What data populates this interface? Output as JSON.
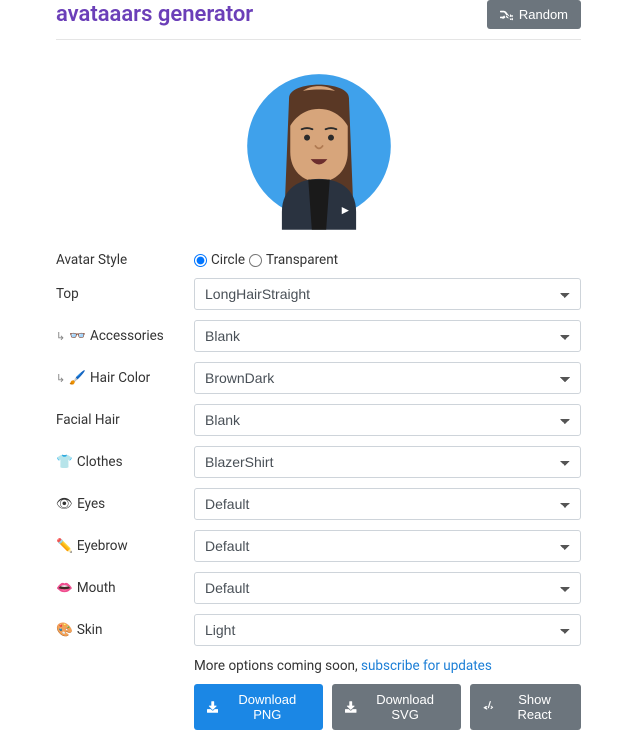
{
  "header": {
    "title": "avataaars generator",
    "random_label": "Random"
  },
  "style_row": {
    "label": "Avatar Style",
    "option_circle": "Circle",
    "option_transparent": "Transparent",
    "selected": "Circle"
  },
  "rows": {
    "top": {
      "label": "Top",
      "value": "LongHairStraight"
    },
    "accessories": {
      "label": "Accessories",
      "icon_hint": "glasses",
      "value": "Blank"
    },
    "hair_color": {
      "label": "Hair Color",
      "icon_hint": "brush",
      "value": "BrownDark"
    },
    "facial_hair": {
      "label": "Facial Hair",
      "value": "Blank"
    },
    "clothes": {
      "label": "Clothes",
      "icon_hint": "shirt",
      "value": "BlazerShirt"
    },
    "eyes": {
      "label": "Eyes",
      "icon_hint": "eye",
      "value": "Default"
    },
    "eyebrow": {
      "label": "Eyebrow",
      "icon_hint": "brow",
      "value": "Default"
    },
    "mouth": {
      "label": "Mouth",
      "icon_hint": "mouth",
      "value": "Default"
    },
    "skin": {
      "label": "Skin",
      "icon_hint": "palette",
      "value": "Light"
    }
  },
  "footer": {
    "more_text": "More options coming soon, ",
    "subscribe_text": "subscribe for updates",
    "download_png": "Download PNG",
    "download_svg": "Download SVG",
    "show_react": "Show React"
  },
  "avatar": {
    "bg_color": "#3fa1eb",
    "hair_color": "#5a3825",
    "skin_color": "#d7a57b",
    "blazer_color": "#2a3340",
    "shirt_color": "#1a1a1a"
  }
}
